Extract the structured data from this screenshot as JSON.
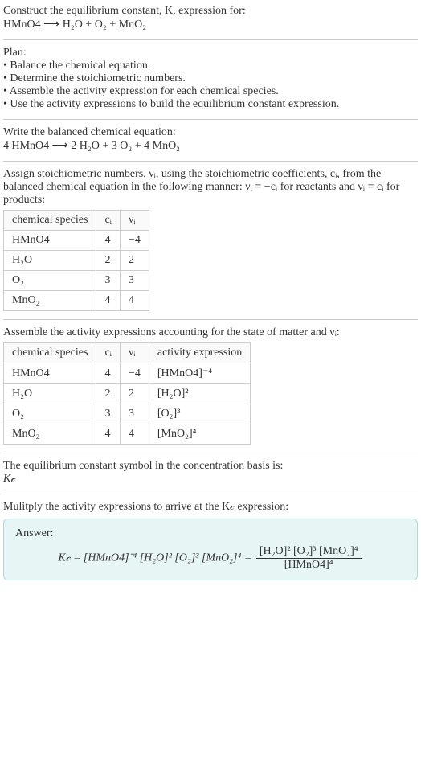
{
  "intro": {
    "line1": "Construct the equilibrium constant, K, expression for:",
    "eq_lhs": "HMnO4 ",
    "arrow": "⟶",
    "eq_rhs": " H₂O + O₂ + MnO₂"
  },
  "plan": {
    "title": "Plan:",
    "b1": "• Balance the chemical equation.",
    "b2": "• Determine the stoichiometric numbers.",
    "b3": "• Assemble the activity expression for each chemical species.",
    "b4": "• Use the activity expressions to build the equilibrium constant expression."
  },
  "balanced": {
    "title": "Write the balanced chemical equation:",
    "eq": "4 HMnO4  ⟶  2 H₂O + 3 O₂ + 4 MnO₂"
  },
  "assign": {
    "text_a": "Assign stoichiometric numbers, νᵢ, using the stoichiometric coefficients, cᵢ, from the balanced chemical equation in the following manner: νᵢ = −cᵢ for reactants and νᵢ = cᵢ for products:",
    "h1": "chemical species",
    "h2": "cᵢ",
    "h3": "νᵢ",
    "rows": [
      {
        "sp": "HMnO4",
        "c": "4",
        "v": "−4"
      },
      {
        "sp": "H₂O",
        "c": "2",
        "v": "2"
      },
      {
        "sp": "O₂",
        "c": "3",
        "v": "3"
      },
      {
        "sp": "MnO₂",
        "c": "4",
        "v": "4"
      }
    ]
  },
  "assemble": {
    "text": "Assemble the activity expressions accounting for the state of matter and νᵢ:",
    "h1": "chemical species",
    "h2": "cᵢ",
    "h3": "νᵢ",
    "h4": "activity expression",
    "rows": [
      {
        "sp": "HMnO4",
        "c": "4",
        "v": "−4",
        "a": "[HMnO4]⁻⁴"
      },
      {
        "sp": "H₂O",
        "c": "2",
        "v": "2",
        "a": "[H₂O]²"
      },
      {
        "sp": "O₂",
        "c": "3",
        "v": "3",
        "a": "[O₂]³"
      },
      {
        "sp": "MnO₂",
        "c": "4",
        "v": "4",
        "a": "[MnO₂]⁴"
      }
    ]
  },
  "symbol": {
    "line1": "The equilibrium constant symbol in the concentration basis is:",
    "line2": "K𝒸"
  },
  "mult": {
    "text": "Mulitply the activity expressions to arrive at the K𝒸 expression:"
  },
  "answer": {
    "label": "Answer:",
    "lhs": "K𝒸 = [HMnO4]⁻⁴ [H₂O]² [O₂]³ [MnO₂]⁴ = ",
    "num": "[H₂O]² [O₂]³ [MnO₂]⁴",
    "den": "[HMnO4]⁴"
  }
}
